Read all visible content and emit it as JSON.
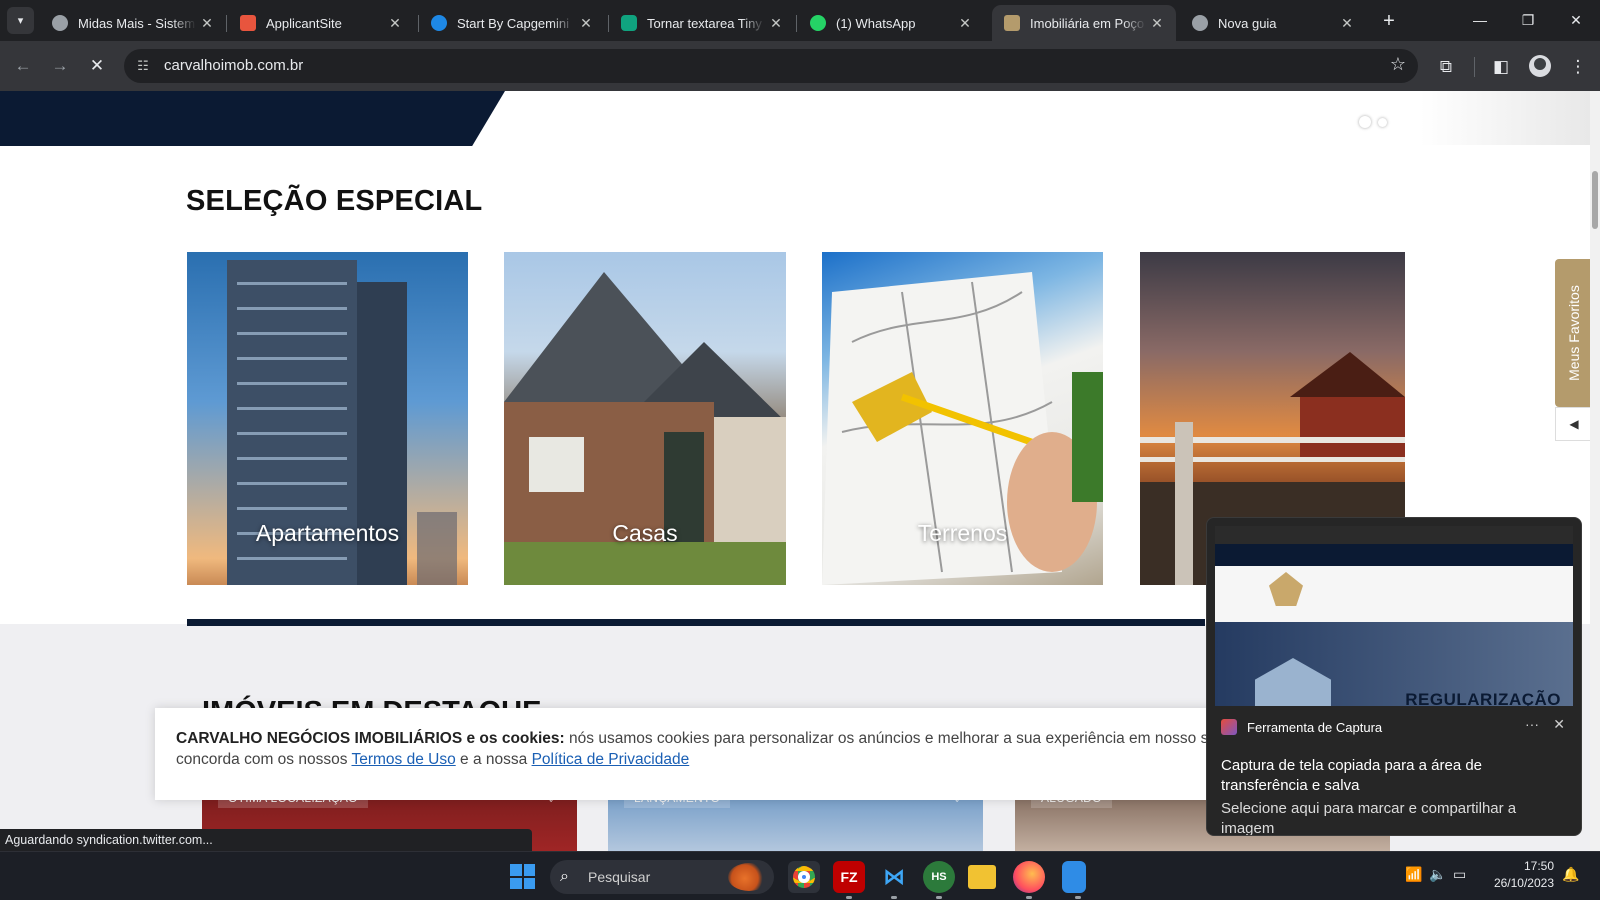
{
  "browser": {
    "tabs": [
      {
        "title": "Midas Mais - Sistem",
        "favicon_color": "#9aa0a6"
      },
      {
        "title": "ApplicantSite",
        "favicon_color": "#e8553e"
      },
      {
        "title": "Start By Capgemini",
        "favicon_color": "#1e88e5"
      },
      {
        "title": "Tornar textarea Tiny",
        "favicon_color": "#10a37f"
      },
      {
        "title": "(1) WhatsApp",
        "favicon_color": "#25d366"
      },
      {
        "title": "Imobiliária em Poço",
        "favicon_color": "#b49b6c",
        "active": true
      },
      {
        "title": "Nova guia",
        "favicon_color": "#9aa0a6"
      }
    ],
    "url": "carvalhoimob.com.br",
    "status_text": "Aguardando syndication.twitter.com..."
  },
  "page": {
    "special_selection": {
      "title": "SELEÇÃO ESPECIAL",
      "categories": [
        "Apartamentos",
        "Casas",
        "Terrenos",
        ""
      ]
    },
    "featured": {
      "title": "IMÓVEIS EM DESTAQUE",
      "badges": [
        "ÓTIMA LOCALIZAÇÃO",
        "LANÇAMENTO",
        "ALUGADO"
      ]
    },
    "favorites_tab": "Meus Favoritos",
    "cookie": {
      "company": "CARVALHO NEGÓCIOS IMOBILIÁRIOS e os cookies:",
      "text": "nós usamos cookies para personalizar os anúncios e melhorar a sua experiência em nosso site. Ao continuar navegando, você concorda com os nossos",
      "terms_link": "Termos de Uso",
      "connector": "e a nossa",
      "privacy_link": "Política de Privacidade"
    }
  },
  "notification": {
    "app": "Ferramenta de Captura",
    "message": "Captura de tela copiada para a área de transferência e salva",
    "sub": "Selecione aqui para marcar e compartilhar a imagem",
    "more": "···",
    "preview_headline": "REGULARIZAÇÃO"
  },
  "taskbar": {
    "search_placeholder": "Pesquisar",
    "time": "17:50",
    "date": "26/10/2023",
    "apps": [
      "chrome",
      "filezilla",
      "vscode",
      "hs",
      "explorer",
      "firefox",
      "notepad"
    ]
  },
  "colors": {
    "navy": "#0b1a33",
    "gold": "#b49b6c",
    "link": "#1a5fb4"
  }
}
